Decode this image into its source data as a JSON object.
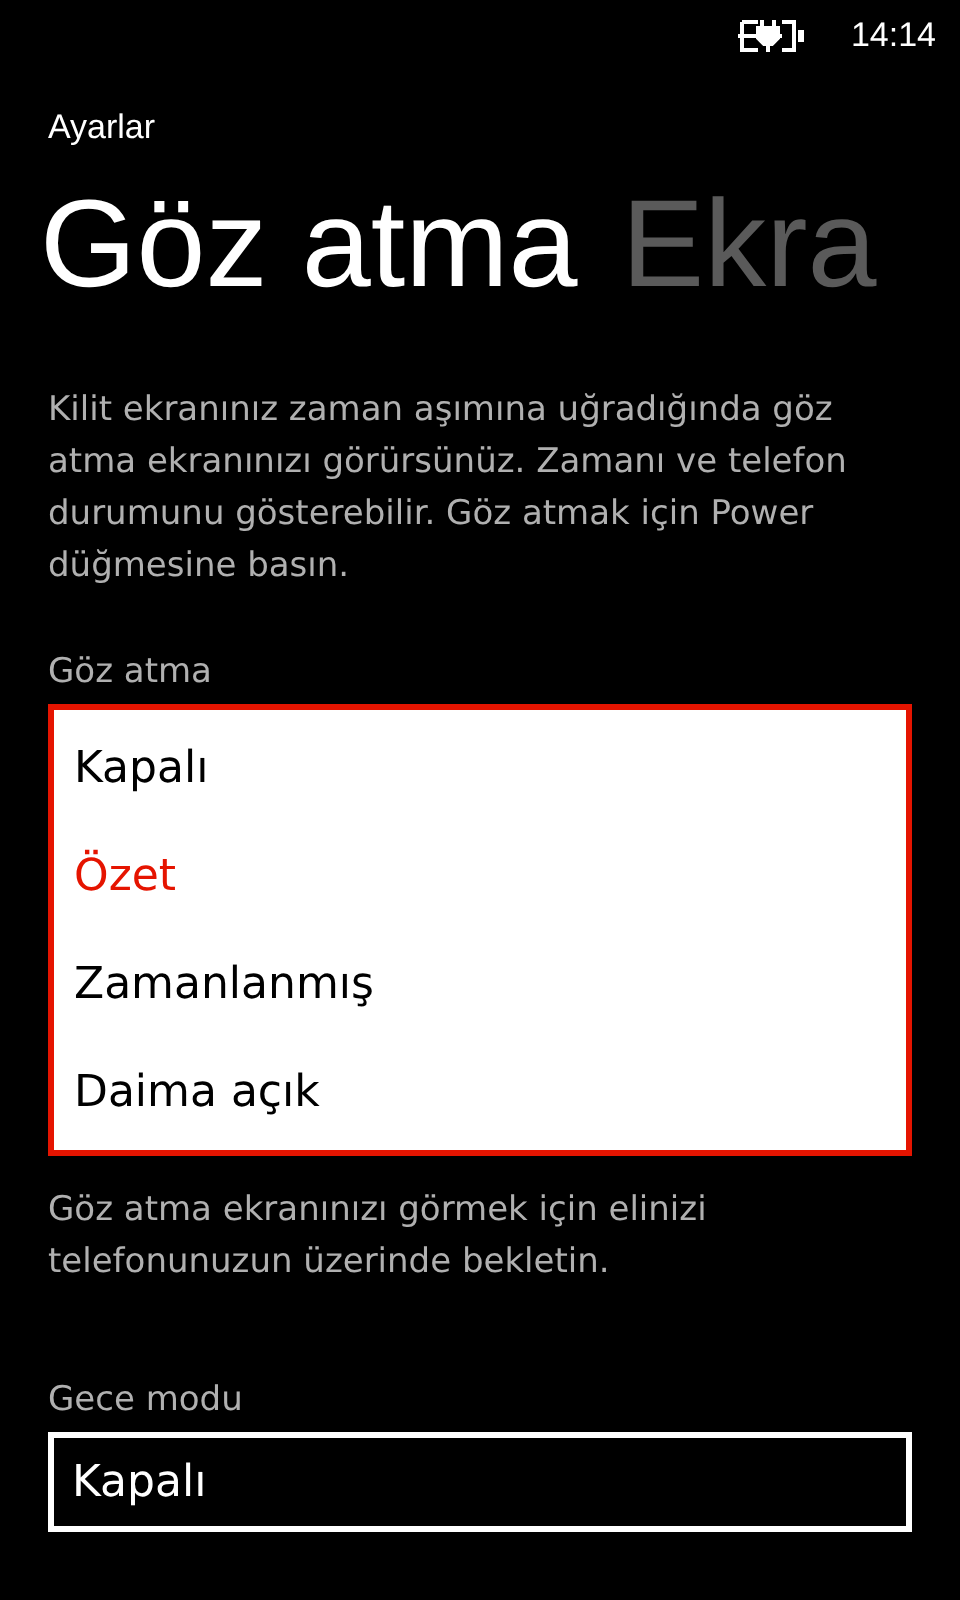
{
  "status_bar": {
    "time": "14:14",
    "charging": true
  },
  "app_title": "Ayarlar",
  "pivots": [
    {
      "label": "Göz atma",
      "selected": true
    },
    {
      "label": "Ekra",
      "selected": false
    }
  ],
  "description": "Kilit ekranınız zaman aşımına uğradığında göz atma ekranınızı görürsünüz. Zamanı ve telefon durumunu gösterebilir. Göz atmak için Power düğmesine basın.",
  "glance": {
    "label": "Göz atma",
    "options": [
      {
        "label": "Kapalı",
        "selected": false
      },
      {
        "label": "Özet",
        "selected": true
      },
      {
        "label": "Zamanlanmış",
        "selected": false
      },
      {
        "label": "Daima açık",
        "selected": false
      }
    ],
    "hint": "Göz atma ekranınızı görmek için elinizi telefonunuzun üzerinde bekletin."
  },
  "night_mode": {
    "label": "Gece modu",
    "value": "Kapalı"
  }
}
